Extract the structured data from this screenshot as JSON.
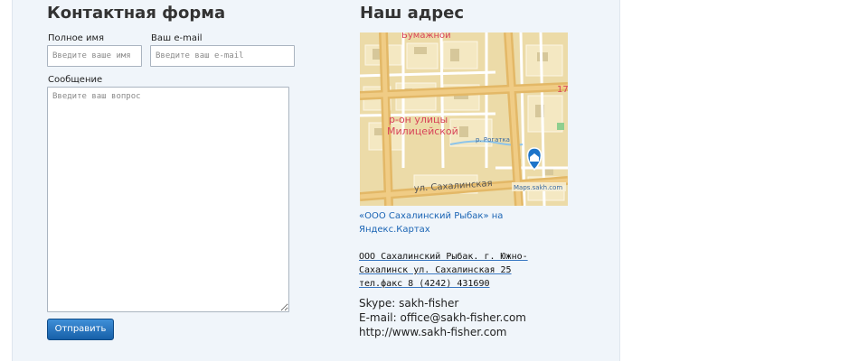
{
  "contact_form": {
    "title": "Контактная форма",
    "full_name_label": "Полное имя",
    "full_name_placeholder": "Введите ваше имя",
    "full_name_value": "",
    "email_label": "Ваш e-mail",
    "email_placeholder": "Введите ваш e-mail",
    "email_value": "",
    "message_label": "Сообщение",
    "message_placeholder": "Введите ваш вопрос",
    "message_value": "",
    "submit_label": "Отправить"
  },
  "address": {
    "title": "Наш адрес",
    "map": {
      "street_top": "Бумажной",
      "district_line1": "р-он улицы",
      "district_line2": "Милицейской",
      "river_label": "р. Рогатка",
      "street_bottom": "ул. Сахалинская",
      "house_number": "17",
      "watermark": "Maps.sakh.com",
      "pin_icon": "home-pin-icon",
      "pin_color": "#1d74c9"
    },
    "map_link": "«ООО Сахалинский Рыбак» на Яндекс.Картах",
    "company_line": "ООО Сахалинский Рыбак. г. Южно-Сахалинск ул. Сахалинская 25 тел.факс 8 (4242) 431690",
    "skype": "Skype: sakh-fisher",
    "email": "E-mail: office@sakh-fisher.com",
    "website": "http://www.sakh-fisher.com"
  },
  "colors": {
    "panel_bg": "#f0f5fa",
    "button_blue": "#1760a8",
    "link_blue": "#1a64b4"
  }
}
